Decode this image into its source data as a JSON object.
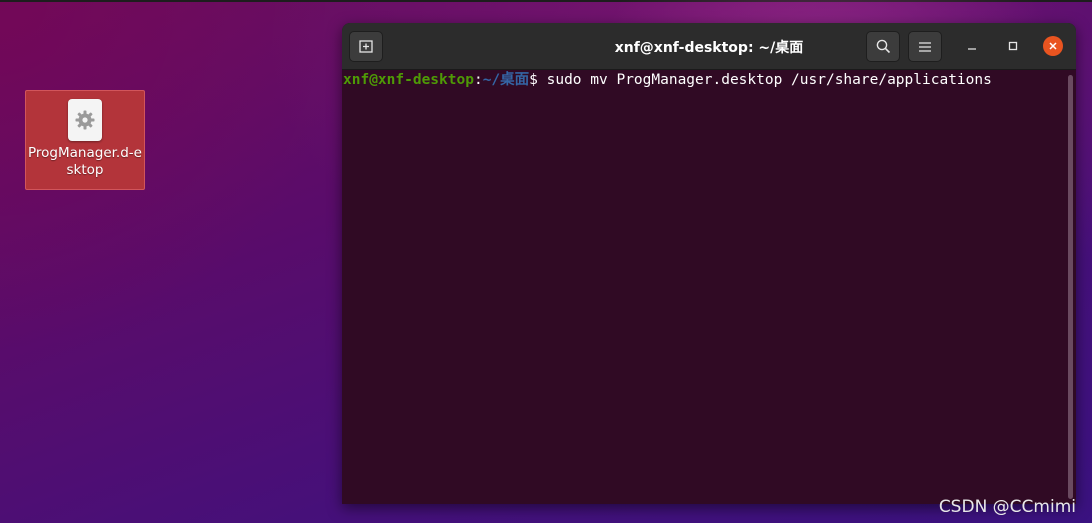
{
  "desktop": {
    "icon": {
      "label": "ProgManager.d-esktop",
      "icon_name": "gear-icon"
    }
  },
  "terminal": {
    "title": "xnf@xnf-desktop: ~/桌面",
    "buttons": {
      "new_tab": "new-tab-icon",
      "search": "search-icon",
      "menu": "hamburger-menu-icon",
      "minimize": "minimize-icon",
      "maximize": "maximize-icon",
      "close": "close-icon"
    },
    "prompt": {
      "user_host": "xnf@xnf-desktop",
      "separator": ":",
      "path": "~/桌面",
      "symbol": "$",
      "command": " sudo mv ProgManager.desktop /usr/share/applications"
    }
  },
  "watermark": "CSDN @CCmimi",
  "colors": {
    "terminal_bg": "#300a24",
    "prompt_user": "#4e9a06",
    "prompt_path": "#3465a4",
    "close_button": "#e95420",
    "icon_selection": "#b3343a"
  }
}
